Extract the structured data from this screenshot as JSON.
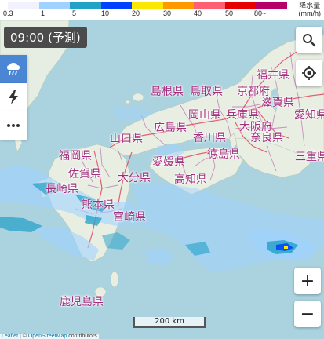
{
  "legend": {
    "unit_line1": "降水量",
    "unit_line2": "(mm/h)",
    "colors": [
      "#f2f2ff",
      "#a0d2ff",
      "#21a0c8",
      "#0041ff",
      "#fae800",
      "#ff9900",
      "#ff5f72",
      "#e60000",
      "#b40068"
    ],
    "labels": [
      "0.3",
      "1",
      "5",
      "10",
      "20",
      "30",
      "40",
      "50",
      "80~"
    ]
  },
  "time_label": "09:00 (予測)",
  "left_controls": [
    {
      "name": "rain-cloud-icon",
      "active": true
    },
    {
      "name": "lightning-icon",
      "active": false
    },
    {
      "name": "more-dots-icon",
      "active": false
    }
  ],
  "right_controls": [
    "search-icon",
    "locate-icon"
  ],
  "zoom": {
    "in": "+",
    "out": "−"
  },
  "prefectures": [
    "福井県",
    "島根県",
    "鳥取県",
    "京都府",
    "滋賀県",
    "岡山県",
    "兵庫県",
    "愛知県",
    "広島県",
    "大阪府",
    "山口県",
    "香川県",
    "奈良県",
    "福岡県",
    "徳島県",
    "三重県",
    "愛媛県",
    "佐賀県",
    "大分県",
    "高知県",
    "長崎県",
    "熊本県",
    "宮崎県",
    "鹿児島県"
  ],
  "scale_label": "200 km",
  "attribution": {
    "leaflet": "Leaflet",
    "sep": " | © ",
    "osm": "OpenStreetMap",
    "contrib": " contributors"
  }
}
